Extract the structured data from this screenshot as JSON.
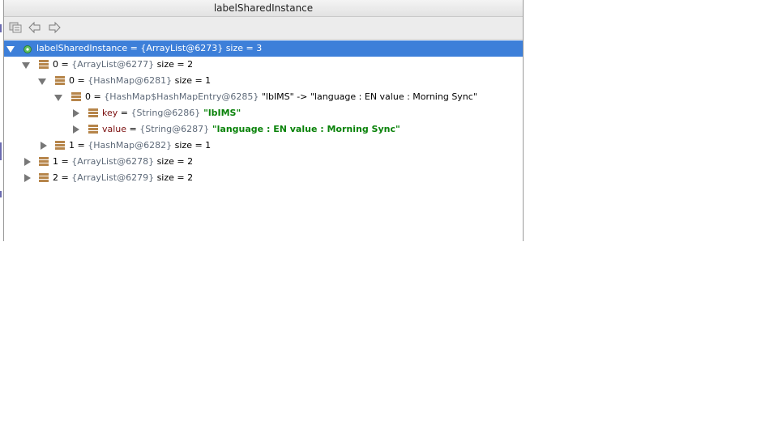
{
  "window": {
    "title": "labelSharedInstance"
  },
  "toolbar": {
    "icons": [
      "copy-icon",
      "back-arrow-icon",
      "forward-arrow-icon"
    ]
  },
  "colors": {
    "selection": "#3d7fd9",
    "field_icon": "#b6854a",
    "string_value": "#098209",
    "key_name": "#7a0d0d"
  },
  "tree": {
    "root": {
      "name": "labelSharedInstance",
      "eq": " = ",
      "addr": "{ArrayList@6273}",
      "extra": "  size = 3"
    },
    "item0": {
      "name": "0",
      "eq": " = ",
      "addr": "{ArrayList@6277}",
      "extra": "  size = 2"
    },
    "item0_0": {
      "name": "0",
      "eq": " = ",
      "addr": "{HashMap@6281}",
      "extra": "  size = 1"
    },
    "item0_0_0": {
      "name": "0",
      "eq": " = ",
      "addr": "{HashMap$HashMapEntry@6285}",
      "extra": " \"lbIMS\" -> \"language : EN value : Morning Sync\""
    },
    "key": {
      "name": "key",
      "eq": " = ",
      "addr": "{String@6286}",
      "value": " \"lbIMS\""
    },
    "value": {
      "name": "value",
      "eq": " = ",
      "addr": "{String@6287}",
      "value": " \"language : EN value : Morning Sync\""
    },
    "item0_1": {
      "name": "1",
      "eq": " = ",
      "addr": "{HashMap@6282}",
      "extra": "  size = 1"
    },
    "item1": {
      "name": "1",
      "eq": " = ",
      "addr": "{ArrayList@6278}",
      "extra": "  size = 2"
    },
    "item2": {
      "name": "2",
      "eq": " = ",
      "addr": "{ArrayList@6279}",
      "extra": "  size = 2"
    }
  }
}
